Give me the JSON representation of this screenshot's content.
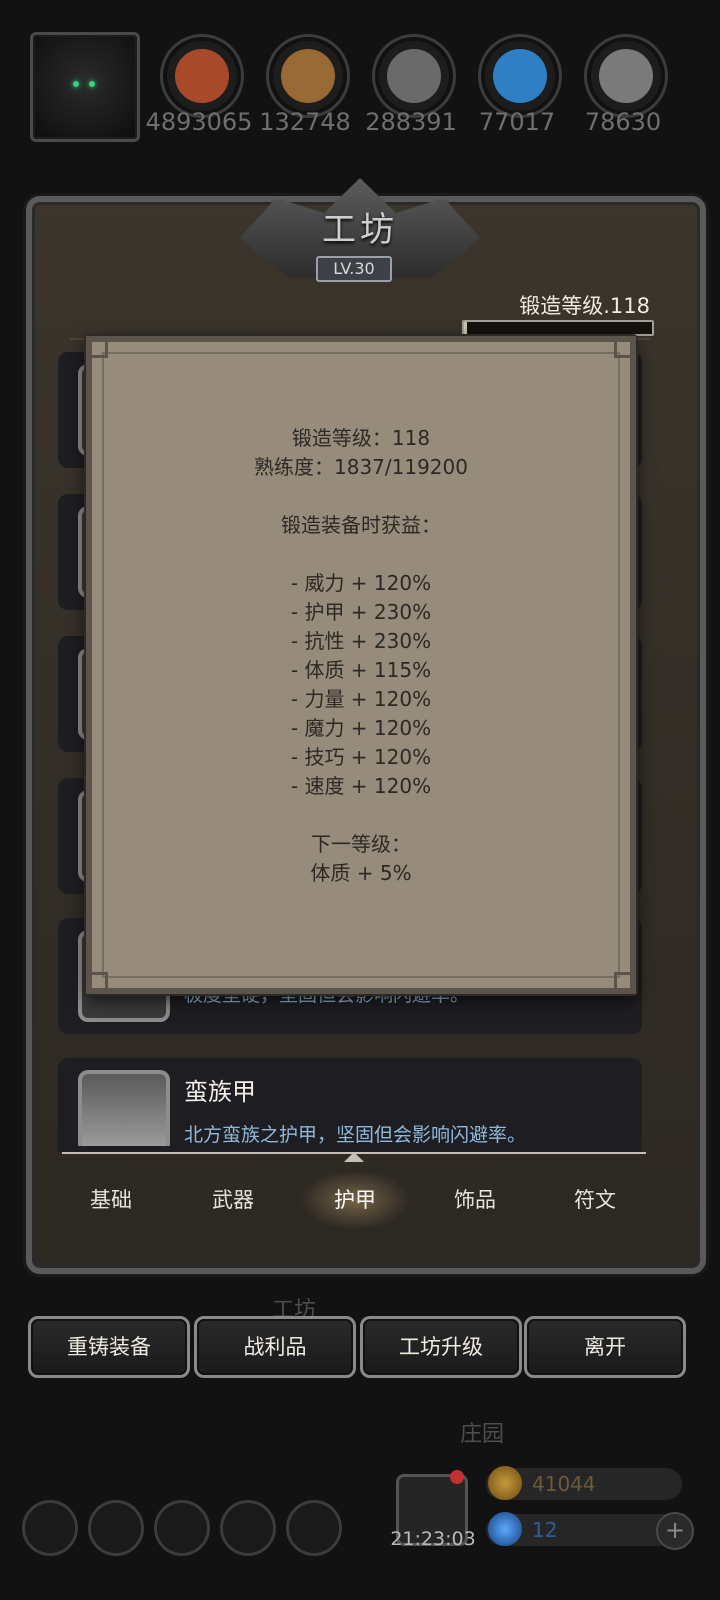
{
  "resources": [
    {
      "icon": "meat-icon",
      "count": "4893065",
      "color": "#a84a2a"
    },
    {
      "icon": "wood-planks-icon",
      "count": "132748",
      "color": "#9a6a36"
    },
    {
      "icon": "iron-ingot-icon",
      "count": "288391",
      "color": "#6a6a6a"
    },
    {
      "icon": "crystal-icon",
      "count": "77017",
      "color": "#2f7fc4"
    },
    {
      "icon": "steel-ingot-icon",
      "count": "78630",
      "color": "#7a7a7a"
    }
  ],
  "panel": {
    "title": "工坊",
    "level": "LV.30",
    "forge_level": "锻造等级.118",
    "forge_progress": 0.015
  },
  "items": [
    {
      "name": "",
      "desc": "极度坚硬，坚固但会影响闪避率。"
    },
    {
      "name": "蛮族甲",
      "desc": "北方蛮族之护甲，坚固但会影响闪避率。"
    }
  ],
  "tabs": [
    "基础",
    "武器",
    "护甲",
    "饰品",
    "符文"
  ],
  "active_tab": 2,
  "actions": [
    "重铸装备",
    "战利品",
    "工坊升级",
    "离开"
  ],
  "background_labels": {
    "workshop": "工坊",
    "manor": "庄园"
  },
  "bottom_bar": {
    "clock": "21:23:03",
    "gold": "41044",
    "gems": "12",
    "plus": "+"
  },
  "tooltip": {
    "lines": [
      "锻造等级：118",
      "熟练度：1837/119200",
      "",
      "锻造装备时获益：",
      "",
      "- 威力 + 120%",
      "- 护甲 + 230%",
      "- 抗性 + 230%",
      "- 体质 + 115%",
      "- 力量 + 120%",
      "- 魔力 + 120%",
      "- 技巧 + 120%",
      "- 速度 + 120%",
      "",
      "下一等级：",
      "体质 + 5%"
    ]
  }
}
